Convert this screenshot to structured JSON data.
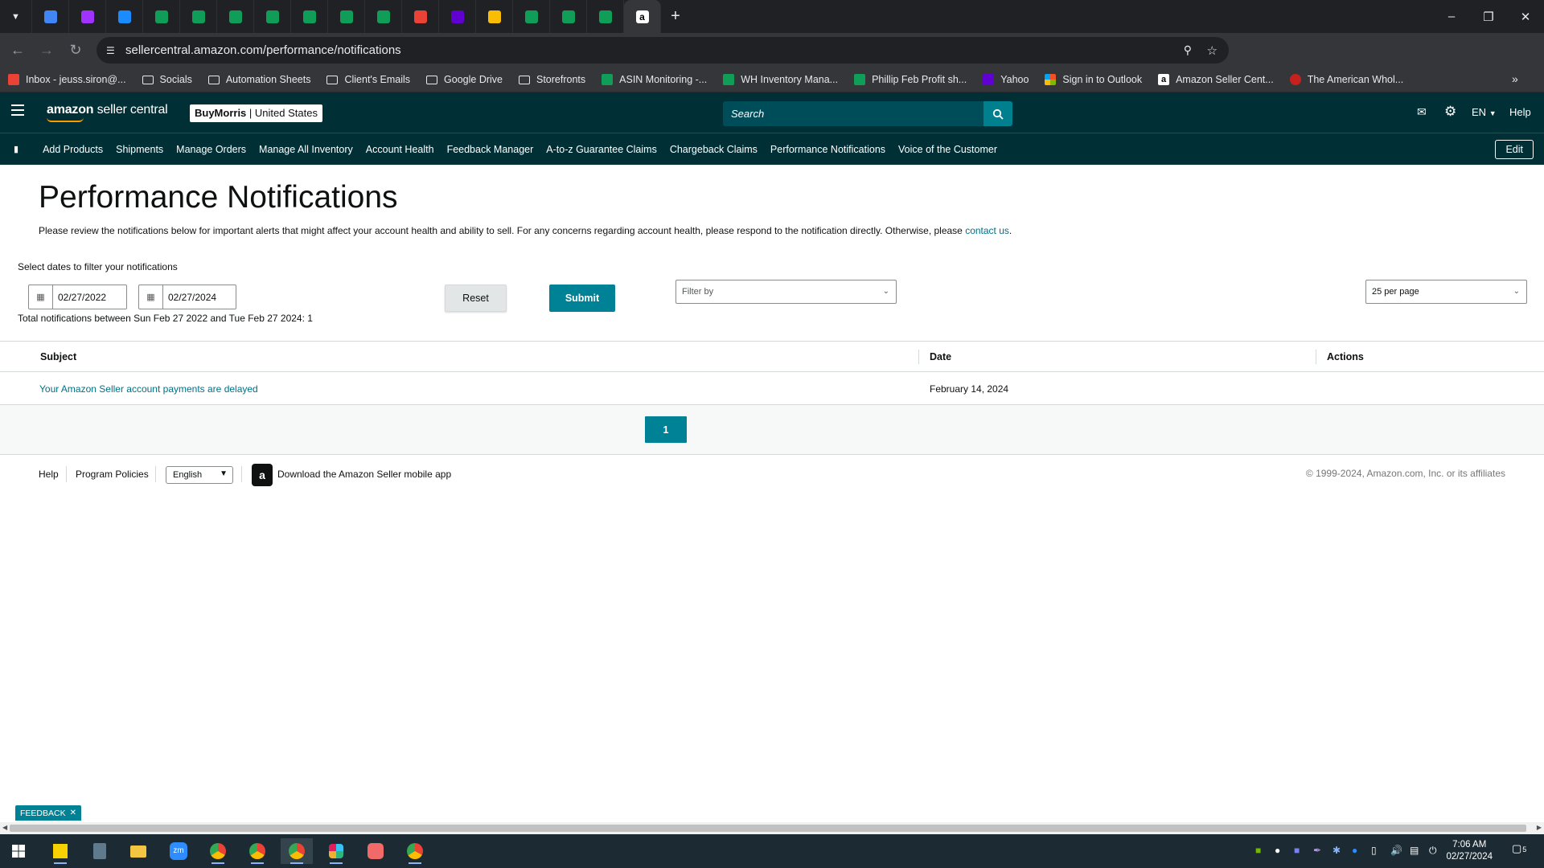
{
  "browser": {
    "tabs": [
      {
        "icon": "docs-icon",
        "color": "#4285f4"
      },
      {
        "icon": "messenger-icon",
        "color": "#a033ff"
      },
      {
        "icon": "onepassword-icon",
        "color": "#1a8cff"
      },
      {
        "icon": "sheets-icon",
        "color": "#0f9d58"
      },
      {
        "icon": "sheets-icon",
        "color": "#0f9d58"
      },
      {
        "icon": "sheets-icon",
        "color": "#0f9d58"
      },
      {
        "icon": "sheets-icon",
        "color": "#0f9d58"
      },
      {
        "icon": "sheets-icon",
        "color": "#0f9d58"
      },
      {
        "icon": "sheets-icon",
        "color": "#0f9d58"
      },
      {
        "icon": "sheets-icon",
        "color": "#0f9d58"
      },
      {
        "icon": "gmail-icon",
        "color": "#ea4335"
      },
      {
        "icon": "yahoo-mail-icon",
        "color": "#6001d2"
      },
      {
        "icon": "google-drive-icon",
        "color": "#fbbc04"
      },
      {
        "icon": "sheets-icon",
        "color": "#0f9d58"
      },
      {
        "icon": "sheets-icon",
        "color": "#0f9d58"
      },
      {
        "icon": "sheets-icon",
        "color": "#0f9d58"
      },
      {
        "icon": "amazon-icon",
        "color": "#ffffff"
      }
    ],
    "url": "sellercentral.amazon.com/performance/notifications",
    "bookmarks": [
      {
        "label": "Inbox - jeuss.siron@...",
        "icon": "gmail-icon"
      },
      {
        "label": "Socials",
        "icon": "folder-icon"
      },
      {
        "label": "Automation Sheets",
        "icon": "folder-icon"
      },
      {
        "label": "Client's Emails",
        "icon": "folder-icon"
      },
      {
        "label": "Google Drive",
        "icon": "folder-icon"
      },
      {
        "label": "Storefronts",
        "icon": "folder-icon"
      },
      {
        "label": "ASIN Monitoring -...",
        "icon": "sheets-icon"
      },
      {
        "label": "WH Inventory Mana...",
        "icon": "sheets-icon"
      },
      {
        "label": "Phillip Feb Profit sh...",
        "icon": "sheets-icon"
      },
      {
        "label": "Yahoo",
        "icon": "yahoo-icon"
      },
      {
        "label": "Sign in to Outlook",
        "icon": "microsoft-icon"
      },
      {
        "label": "Amazon Seller Cent...",
        "icon": "amazon-icon"
      },
      {
        "label": "The American Whol...",
        "icon": "globe-icon"
      }
    ]
  },
  "header": {
    "logo_prefix": "amazon",
    "logo_suffix": "seller central",
    "store_name": "BuyMorris",
    "store_region": "United States",
    "search_placeholder": "Search",
    "language": "EN",
    "help": "Help"
  },
  "nav": {
    "items": [
      "Add Products",
      "Shipments",
      "Manage Orders",
      "Manage All Inventory",
      "Account Health",
      "Feedback Manager",
      "A-to-z Guarantee Claims",
      "Chargeback Claims",
      "Performance Notifications",
      "Voice of the Customer"
    ],
    "edit": "Edit"
  },
  "page": {
    "title": "Performance Notifications",
    "intro": "Please review the notifications below for important alerts that might affect your account health and ability to sell. For any concerns regarding account health, please respond to the notification directly. Otherwise, please",
    "intro_link": "contact us",
    "filter_label": "Select dates to filter your notifications",
    "date_from": "02/27/2022",
    "date_to": "02/27/2024",
    "reset": "Reset",
    "submit": "Submit",
    "filter_by": "Filter by",
    "per_page": "25 per page",
    "total": "Total notifications between Sun Feb 27 2022 and Tue Feb 27 2024: 1"
  },
  "table": {
    "columns": [
      "Subject",
      "Date",
      "Actions"
    ],
    "rows": [
      {
        "subject": "Your Amazon Seller account payments are delayed",
        "date": "February 14, 2024",
        "actions": ""
      }
    ]
  },
  "pagination": {
    "current": "1"
  },
  "footer": {
    "help": "Help",
    "policies": "Program Policies",
    "language": "English",
    "app": "Download the Amazon Seller mobile app",
    "copyright": "© 1999-2024, Amazon.com, Inc. or its affiliates"
  },
  "feedback": "FEEDBACK",
  "taskbar": {
    "time": "7:06 AM",
    "date": "02/27/2024",
    "notification_count": "5"
  }
}
